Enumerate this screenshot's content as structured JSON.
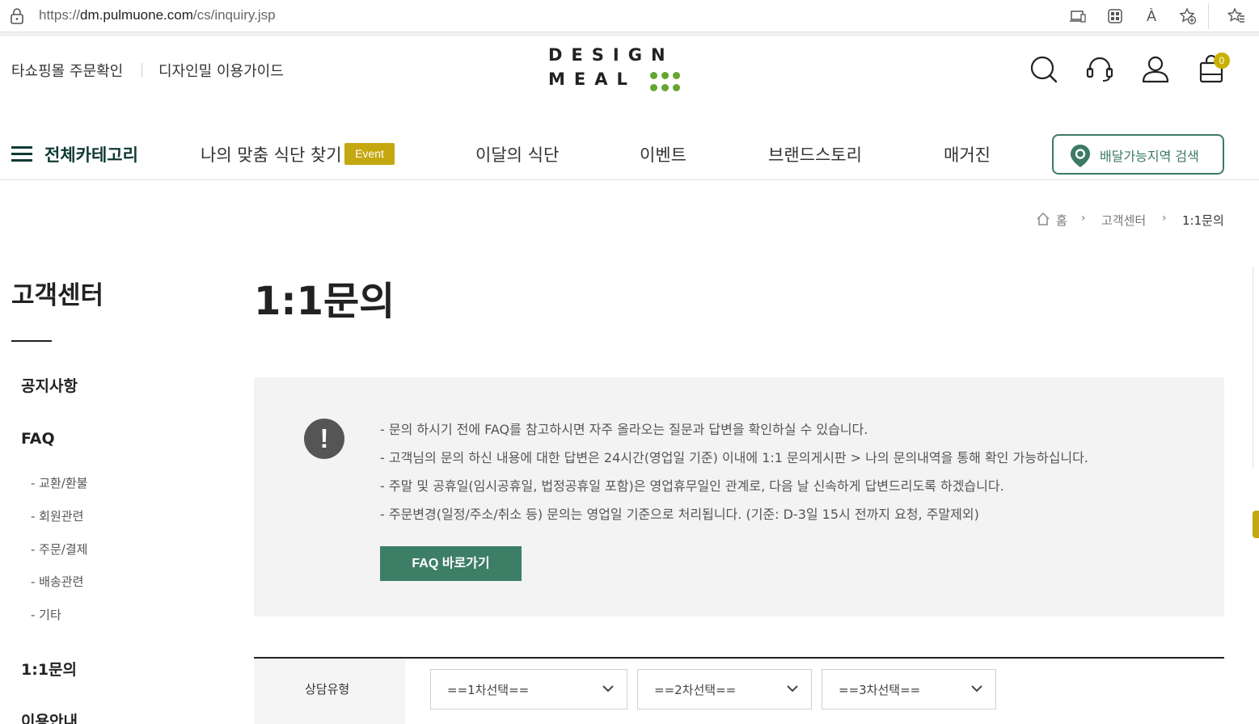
{
  "browser": {
    "url_prefix": "https://",
    "url_host": "dm.pulmuone.com",
    "url_path": "/cs/inquiry.jsp",
    "read_aloud_label": "À"
  },
  "header": {
    "links": [
      "타쇼핑몰 주문확인",
      "디자인밀 이용가이드"
    ],
    "logo": {
      "line1": "DESIGN",
      "line2": "MEAL",
      "dot_color": "#64a631"
    },
    "icons": [
      "search-icon",
      "headset-icon",
      "user-icon",
      "cart-icon"
    ],
    "cart_count": "0"
  },
  "nav": {
    "all_category": "전체카테고리",
    "items": [
      "나의 맞춤 식단 찾기",
      "이달의 식단",
      "이벤트",
      "브랜드스토리",
      "매거진"
    ],
    "event_badge": "Event",
    "delivery_button": "배달가능지역 검색",
    "accent_color": "#3c7a63"
  },
  "breadcrumb": [
    "홈",
    "고객센터",
    "1:1문의"
  ],
  "sidebar": {
    "title": "고객센터",
    "menu": [
      {
        "label": "공지사항"
      },
      {
        "label": "FAQ"
      },
      {
        "label": "1:1문의"
      },
      {
        "label": "이용안내"
      }
    ],
    "faq_sub": [
      "- 교환/환불",
      "- 회원관련",
      "- 주문/결제",
      "- 배송관련",
      "- 기타"
    ]
  },
  "main": {
    "title": "1:1문의",
    "notice_lines": [
      "- 문의 하시기 전에 FAQ를 참고하시면 자주 올라오는 질문과 답변을 확인하실 수 있습니다.",
      "- 고객님의 문의 하신 내용에 대한 답변은 24시간(영업일 기준) 이내에 1:1 문의게시판 > 나의 문의내역을 통해 확인 가능하십니다.",
      "- 주말 및 공휴일(임시공휴일, 법정공휴일 포함)은 영업휴무일인 관계로, 다음 날 신속하게 답변드리도록 하겠습니다.",
      "- 주문변경(일정/주소/취소 등) 문의는 영업일 기준으로 처리됩니다. (기준: D-3일 15시 전까지 요청, 주말제외)"
    ],
    "notice_icon": "!",
    "faq_button": "FAQ 바로가기",
    "form": {
      "label": "상담유형",
      "selects": [
        "==1차선택==",
        "==2차선택==",
        "==3차선택=="
      ]
    }
  }
}
